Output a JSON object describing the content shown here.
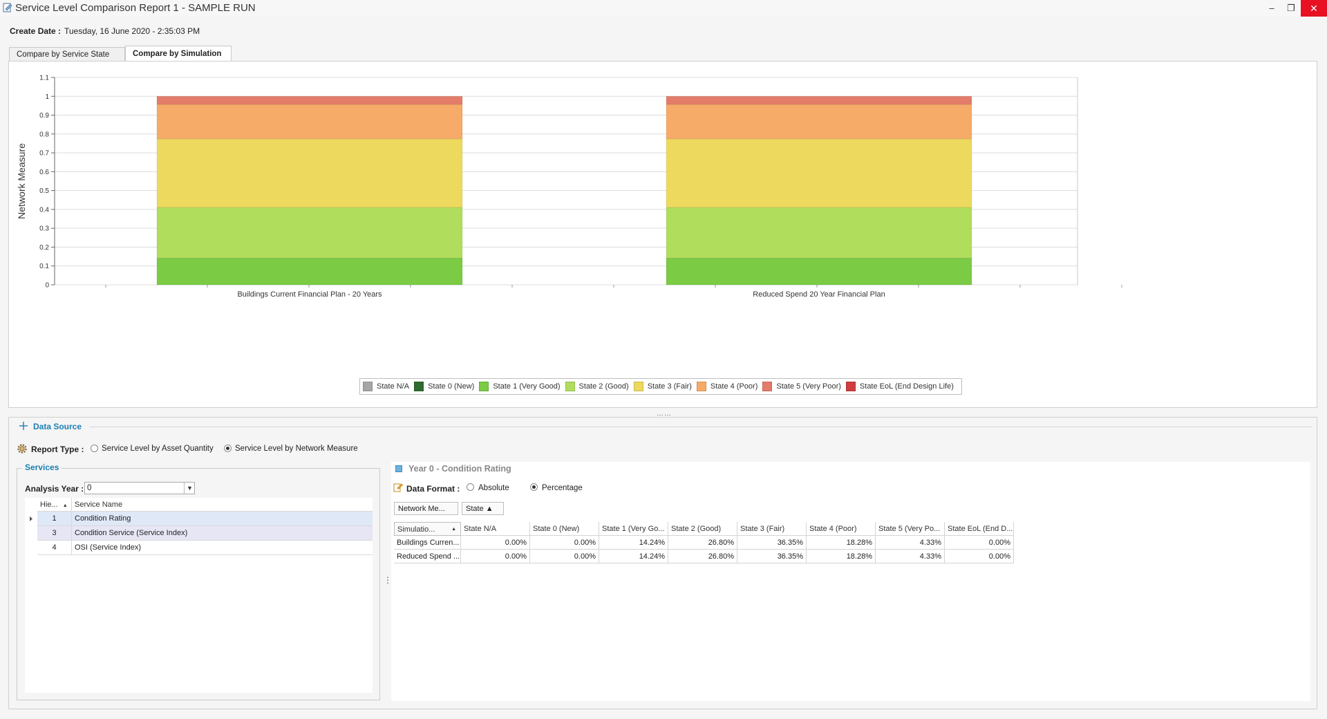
{
  "window": {
    "title": "Service Level Comparison Report 1 - SAMPLE RUN",
    "min_glyph": "–",
    "restore_glyph": "❐",
    "close_glyph": "✕"
  },
  "create_date": {
    "label": "Create Date :",
    "value": "Tuesday, 16 June 2020 - 2:35:03 PM"
  },
  "tabs": [
    {
      "label": "Compare by Service State",
      "active": false
    },
    {
      "label": "Compare by Simulation",
      "active": true
    }
  ],
  "chart_data": {
    "type": "bar",
    "stacked": true,
    "ylabel": "Network Measure",
    "xlabel": "",
    "ylim": [
      0,
      1.1
    ],
    "yticks": [
      "0",
      "0.1",
      "0.2",
      "0.3",
      "0.4",
      "0.5",
      "0.6",
      "0.7",
      "0.8",
      "0.9",
      "1",
      "1.1"
    ],
    "grid": true,
    "legend_position": "bottom",
    "categories": [
      "Buildings Current Financial Plan - 20 Years",
      "Reduced Spend 20 Year Financial Plan"
    ],
    "series": [
      {
        "name": "State N/A",
        "color": "#a6a6a6",
        "values": [
          0,
          0
        ]
      },
      {
        "name": "State 0 (New)",
        "color": "#2e6b2e",
        "values": [
          0,
          0
        ]
      },
      {
        "name": "State 1 (Very Good)",
        "color": "#7bcb45",
        "values": [
          0.1424,
          0.1424
        ]
      },
      {
        "name": "State 2 (Good)",
        "color": "#b1dd5c",
        "values": [
          0.268,
          0.268
        ]
      },
      {
        "name": "State 3 (Fair)",
        "color": "#ecd95d",
        "values": [
          0.3635,
          0.3635
        ]
      },
      {
        "name": "State 4 (Poor)",
        "color": "#f6ab68",
        "values": [
          0.1828,
          0.1828
        ]
      },
      {
        "name": "State 5 (Very Poor)",
        "color": "#e47c6a",
        "values": [
          0.0433,
          0.0433
        ]
      },
      {
        "name": "State EoL (End Design Life)",
        "color": "#cf3d3d",
        "values": [
          0,
          0
        ]
      }
    ]
  },
  "splitter_glyph": "……",
  "data_source": {
    "title": "Data Source",
    "report_type_label": "Report Type :",
    "options": [
      "Service Level by Asset Quantity",
      "Service Level by Network Measure"
    ],
    "selected": 1
  },
  "services": {
    "title": "Services",
    "analysis_year_label": "Analysis Year :",
    "analysis_year_value": "0",
    "headers": [
      "Hie...",
      "Service Name"
    ],
    "sort_glyph": "▲",
    "rows": [
      {
        "hie": "1",
        "name": "Condition Rating"
      },
      {
        "hie": "3",
        "name": "Condition Service (Service Index)"
      },
      {
        "hie": "4",
        "name": "OSI (Service Index)"
      }
    ]
  },
  "vsplit_glyph": "⋮",
  "result": {
    "title": "Year 0 - Condition Rating",
    "data_format_label": "Data Format :",
    "format_options": [
      "Absolute",
      "Percentage"
    ],
    "format_selected": 1,
    "group_chips": [
      "Network Me...",
      "State ▲"
    ],
    "row_header": "Simulatio...",
    "columns": [
      "State N/A",
      "State 0 (New)",
      "State 1 (Very Go...",
      "State 2 (Good)",
      "State 3 (Fair)",
      "State 4 (Poor)",
      "State 5 (Very Po...",
      "State EoL (End D..."
    ],
    "rows": [
      {
        "name": "Buildings Curren...",
        "values": [
          "0.00%",
          "0.00%",
          "14.24%",
          "26.80%",
          "36.35%",
          "18.28%",
          "4.33%",
          "0.00%"
        ]
      },
      {
        "name": "Reduced Spend ...",
        "values": [
          "0.00%",
          "0.00%",
          "14.24%",
          "26.80%",
          "36.35%",
          "18.28%",
          "4.33%",
          "0.00%"
        ]
      }
    ]
  }
}
